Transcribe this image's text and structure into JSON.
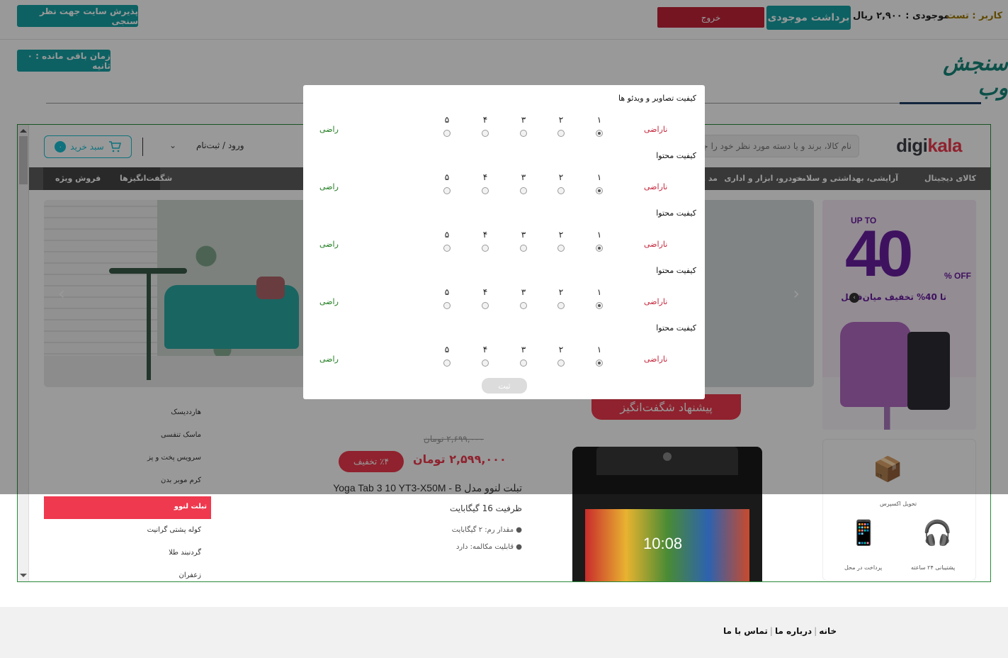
{
  "topbar": {
    "accept_button": "پذیرش سایت جهت نظر سنجی",
    "logout_button": "خروج",
    "withdraw_button": "برداشت موجودی",
    "balance_text": "موجودی : ۲,۹۰۰ ریال",
    "user_key": "کاربر :",
    "user_name": "تست",
    "timer_text": "زمان باقی مانده : ۰ ثانیه",
    "brand": "سنجش وب"
  },
  "site": {
    "logo_main": "digi",
    "logo_accent": "kala",
    "search_placeholder": "نام کالا، برند و یا دسته مورد نظر خود را جستجو کنید",
    "cart_label": "سبد خرید",
    "cart_count": "۰",
    "login_label": "ورود / ثبت‌نام",
    "nav": [
      "کالای دیجیتال",
      "آرایشی، بهداشتی و سلامت",
      "خودرو، ابزار و اداری",
      "مد و پوشاک",
      "شگفت‌انگیزها",
      "فروش ویژه"
    ],
    "promo": {
      "upto": "UP TO",
      "big": "40",
      "off": "% OFF",
      "sub": "تا 40% تخفیف میان‌فصل"
    },
    "services": [
      "تحویل اکسپرس",
      "پشتیبانی ۲۴ ساعته",
      "پرداخت در محل"
    ],
    "categories": [
      "هارددیسک",
      "ماسک تنفسی",
      "سرویس پخت و پز",
      "کرم موبر بدن",
      "تبلت لنوو",
      "کوله پشتی گرانیت",
      "گردنبند طلا",
      "زعفران"
    ],
    "active_category": "تبلت لنوو",
    "offer": {
      "ribbon": "پیشنهاد شگفت‌انگیز",
      "old_price": "۲,۶۹۹,۰۰۰ تومان",
      "new_price": "۲,۵۹۹,۰۰۰ تومان",
      "discount": "٪۴ تخفیف",
      "title": "تبلت لنوو مدل Yoga Tab 3 10 YT3-X50M - B",
      "subtitle": "ظرفیت 16 گیگابایت",
      "specs": [
        "مقدار رم: ۲ گیگابایت",
        "قابلیت مکالمه: دارد"
      ],
      "clock": "10:08"
    }
  },
  "modal": {
    "questions": [
      {
        "title": "کیفیت تصاویر و ویدئو ها",
        "selected": 1
      },
      {
        "title": "کیفیت محتوا",
        "selected": 1
      },
      {
        "title": "کیفیت محتوا",
        "selected": 1
      },
      {
        "title": "کیفیت محتوا",
        "selected": 1
      },
      {
        "title": "کیفیت محتوا",
        "selected": 1
      }
    ],
    "scale": [
      "۱",
      "۲",
      "۳",
      "۴",
      "۵"
    ],
    "low_label": "ناراضی",
    "high_label": "راضی",
    "submit_label": "ثبت"
  },
  "footer": {
    "links": [
      "خانه",
      "درباره ما",
      "تماس با ما"
    ]
  }
}
